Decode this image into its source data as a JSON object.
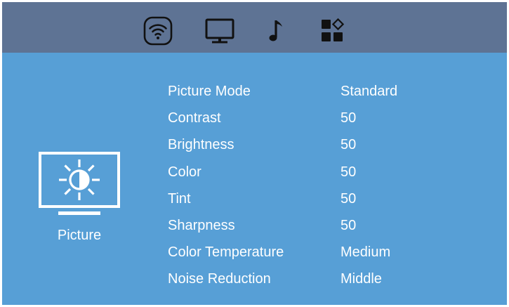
{
  "tabs": [
    {
      "icon": "wifi-icon",
      "selected": true
    },
    {
      "icon": "monitor-icon",
      "selected": false
    },
    {
      "icon": "music-note-icon",
      "selected": false
    },
    {
      "icon": "apps-icon",
      "selected": false
    }
  ],
  "category": {
    "icon": "brightness-monitor-icon",
    "label": "Picture"
  },
  "settings": [
    {
      "label": "Picture Mode",
      "value": "Standard"
    },
    {
      "label": "Contrast",
      "value": "50"
    },
    {
      "label": "Brightness",
      "value": "50"
    },
    {
      "label": "Color",
      "value": "50"
    },
    {
      "label": "Tint",
      "value": "50"
    },
    {
      "label": "Sharpness",
      "value": "50"
    },
    {
      "label": "Color Temperature",
      "value": "Medium"
    },
    {
      "label": "Noise Reduction",
      "value": "Middle"
    }
  ],
  "colors": {
    "topbar": "#5e7394",
    "panel": "#579fd6",
    "text": "#ffffff",
    "icon_dark": "#111111"
  }
}
